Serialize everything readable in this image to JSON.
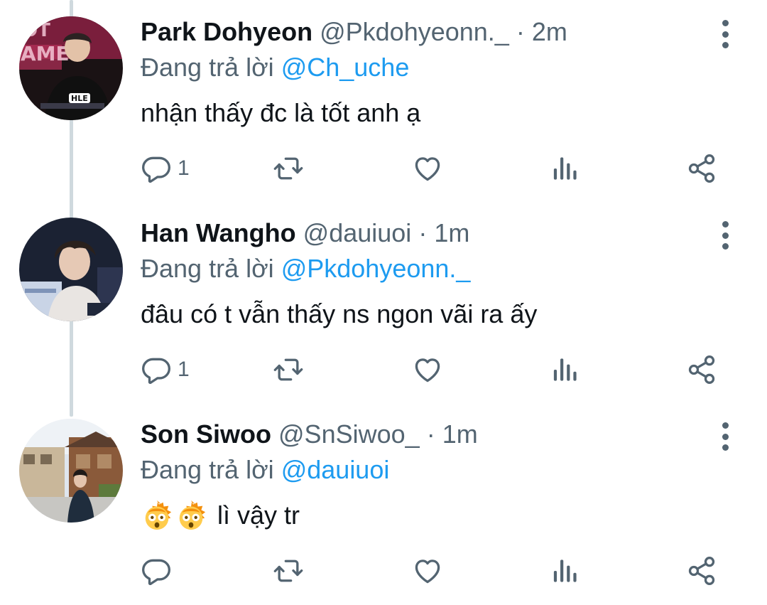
{
  "tweets": [
    {
      "name": "Park Dohyeon",
      "handle": "@Pkdohyeonn._",
      "separator": "·",
      "time": "2m",
      "replying_prefix": "Đang trả lời",
      "replying_to": "@Ch_uche",
      "text": "nhận thấy đc là tốt anh ạ",
      "reply_count": "1",
      "avatar_lettering": "HLE"
    },
    {
      "name": "Han Wangho",
      "handle": "@dauiuoi",
      "separator": "·",
      "time": "1m",
      "replying_prefix": "Đang trả lời",
      "replying_to": "@Pkdohyeonn._",
      "text": "đâu có t vẫn thấy ns ngon vãi ra ấy",
      "reply_count": "1"
    },
    {
      "name": "Son Siwoo",
      "handle": "@SnSiwoo_",
      "separator": "·",
      "time": "1m",
      "replying_prefix": "Đang trả lời",
      "replying_to": "@dauiuoi",
      "text": "lì vậy tr",
      "reply_count": "",
      "emojis": [
        "astonished-face-with-exploding-head",
        "astonished-face-with-exploding-head"
      ]
    }
  ],
  "icons": [
    "reply-icon",
    "retweet-icon",
    "like-icon",
    "views-icon",
    "share-icon",
    "more-options-icon"
  ],
  "colors": {
    "text": "#0f1419",
    "secondary": "#536471",
    "mention": "#1d9bf0",
    "thread_line": "#cfd9de"
  }
}
